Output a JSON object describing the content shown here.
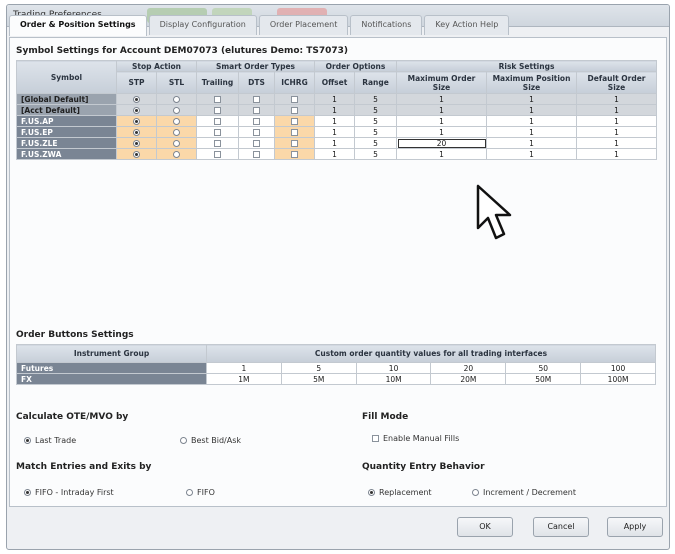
{
  "window": {
    "title": "Trading Preferences"
  },
  "tabs": [
    {
      "label": "Order & Position Settings",
      "active": true
    },
    {
      "label": "Display Configuration"
    },
    {
      "label": "Order Placement"
    },
    {
      "label": "Notifications"
    },
    {
      "label": "Key Action Help"
    }
  ],
  "symbol_settings": {
    "title": "Symbol Settings for Account DEM07073 (elutures Demo: TS7073)",
    "group_headers": {
      "stop_action": "Stop Action",
      "smart_order_types": "Smart Order Types",
      "order_options": "Order Options",
      "risk_settings": "Risk Settings"
    },
    "columns": {
      "symbol": "Symbol",
      "stp": "STP",
      "stl": "STL",
      "trailing": "Trailing",
      "dts": "DTS",
      "ichrg": "ICHRG",
      "offset": "Offset",
      "range": "Range",
      "max_order": "Maximum Order Size",
      "max_position": "Maximum Position Size",
      "default_order": "Default Order Size"
    },
    "rows": [
      {
        "symbol": "[Global Default]",
        "stp": true,
        "stl": false,
        "offset": "1",
        "range": "5",
        "max_order": "1",
        "max_position": "1",
        "default_order": "1"
      },
      {
        "symbol": "[Acct Default]",
        "stp": true,
        "stl": false,
        "offset": "1",
        "range": "5",
        "max_order": "1",
        "max_position": "1",
        "default_order": "1"
      },
      {
        "symbol": "F.US.AP",
        "stp": true,
        "stl": false,
        "offset": "1",
        "range": "5",
        "max_order": "1",
        "max_position": "1",
        "default_order": "1"
      },
      {
        "symbol": "F.US.EP",
        "stp": true,
        "stl": false,
        "offset": "1",
        "range": "5",
        "max_order": "1",
        "max_position": "1",
        "default_order": "1"
      },
      {
        "symbol": "F.US.ZLE",
        "stp": true,
        "stl": false,
        "offset": "1",
        "range": "5",
        "max_order": "20",
        "max_position": "1",
        "default_order": "1"
      },
      {
        "symbol": "F.US.ZWA",
        "stp": true,
        "stl": false,
        "offset": "1",
        "range": "5",
        "max_order": "1",
        "max_position": "1",
        "default_order": "1"
      }
    ]
  },
  "order_buttons": {
    "title": "Order Buttons Settings",
    "header_group": "Instrument Group",
    "header_values": "Custom order quantity values for all trading interfaces",
    "rows": [
      {
        "group": "Futures",
        "values": [
          "1",
          "5",
          "10",
          "20",
          "50",
          "100"
        ]
      },
      {
        "group": "FX",
        "values": [
          "1M",
          "5M",
          "10M",
          "20M",
          "50M",
          "100M"
        ]
      }
    ]
  },
  "calculate": {
    "title": "Calculate OTE/MVO by",
    "opt1": "Last Trade",
    "opt2": "Best Bid/Ask"
  },
  "fill_mode": {
    "title": "Fill Mode",
    "label": "Enable Manual Fills"
  },
  "match": {
    "title": "Match Entries and Exits by",
    "opt1": "FIFO - Intraday First",
    "opt2": "FIFO"
  },
  "qty": {
    "title": "Quantity Entry Behavior",
    "opt1": "Replacement",
    "opt2": "Increment / Decrement"
  },
  "buttons": {
    "ok": "OK",
    "cancel": "Cancel",
    "apply": "Apply"
  }
}
